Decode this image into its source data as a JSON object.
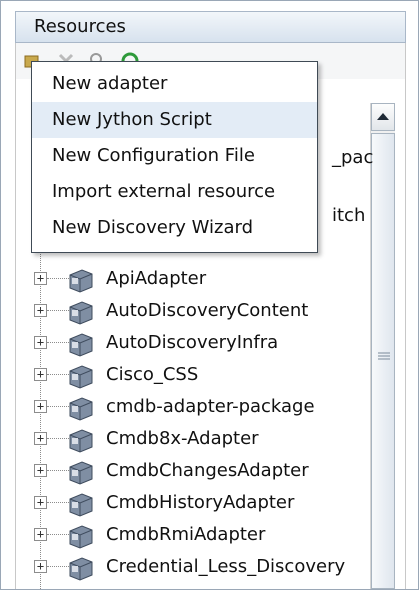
{
  "panel": {
    "title": "Resources"
  },
  "context_menu": {
    "items": [
      {
        "label": "New adapter",
        "highlighted": false
      },
      {
        "label": "New Jython Script",
        "highlighted": true
      },
      {
        "label": "New Configuration File",
        "highlighted": false
      },
      {
        "label": "Import external resource",
        "highlighted": false
      },
      {
        "label": "New Discovery Wizard",
        "highlighted": false
      }
    ]
  },
  "tree": {
    "partially_hidden": [
      "_pac",
      "itch"
    ],
    "items": [
      {
        "label": "ApiAdapter"
      },
      {
        "label": "AutoDiscoveryContent"
      },
      {
        "label": "AutoDiscoveryInfra"
      },
      {
        "label": "Cisco_CSS"
      },
      {
        "label": "cmdb-adapter-package"
      },
      {
        "label": "Cmdb8x-Adapter"
      },
      {
        "label": "CmdbChangesAdapter"
      },
      {
        "label": "CmdbHistoryAdapter"
      },
      {
        "label": "CmdbRmiAdapter"
      },
      {
        "label": "Credential_Less_Discovery"
      }
    ]
  },
  "icons": {
    "expander": "plus-box-icon",
    "package": "package-icon",
    "scroll_up": "arrow-up-icon"
  }
}
